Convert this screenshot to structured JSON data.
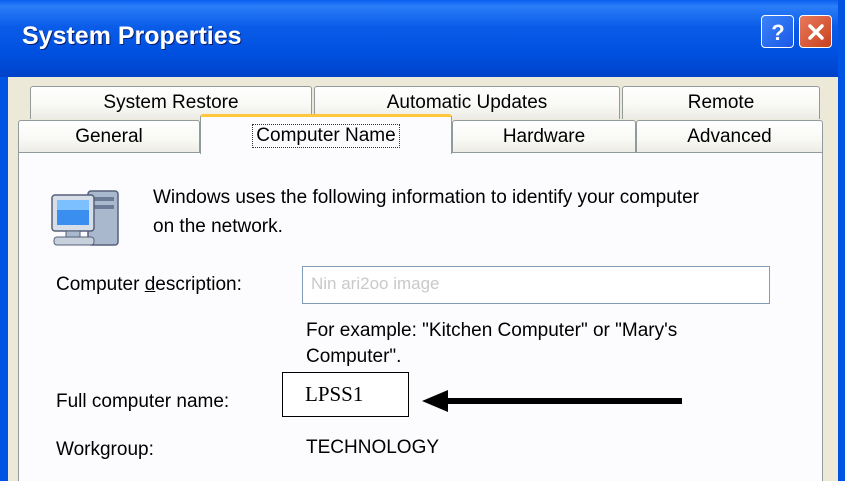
{
  "window": {
    "title": "System Properties",
    "help_icon": "help-question-icon",
    "close_icon": "close-x-icon"
  },
  "tabs": {
    "row1": [
      "System Restore",
      "Automatic Updates",
      "Remote"
    ],
    "row2": [
      "General",
      "Computer Name",
      "Hardware",
      "Advanced"
    ],
    "active": "Computer Name"
  },
  "content": {
    "intro_line1": "Windows uses the following information to identify your computer",
    "intro_line2": "on the network.",
    "description_label_pre": "Computer ",
    "description_label_accel": "d",
    "description_label_post": "escription:",
    "description_value": "Nin ari2oo image",
    "example_line1": "For example: \"Kitchen Computer\" or \"Mary's",
    "example_line2": "Computer\".",
    "full_name_label": "Full computer name:",
    "full_name_value": "LPSS1",
    "workgroup_label": "Workgroup:",
    "workgroup_value": "TECHNOLOGY"
  },
  "colors": {
    "titlebar": "#0054e3",
    "client_bg": "#ece9d8",
    "active_tab_highlight": "#ffc83c",
    "close_button": "#d9502e"
  }
}
